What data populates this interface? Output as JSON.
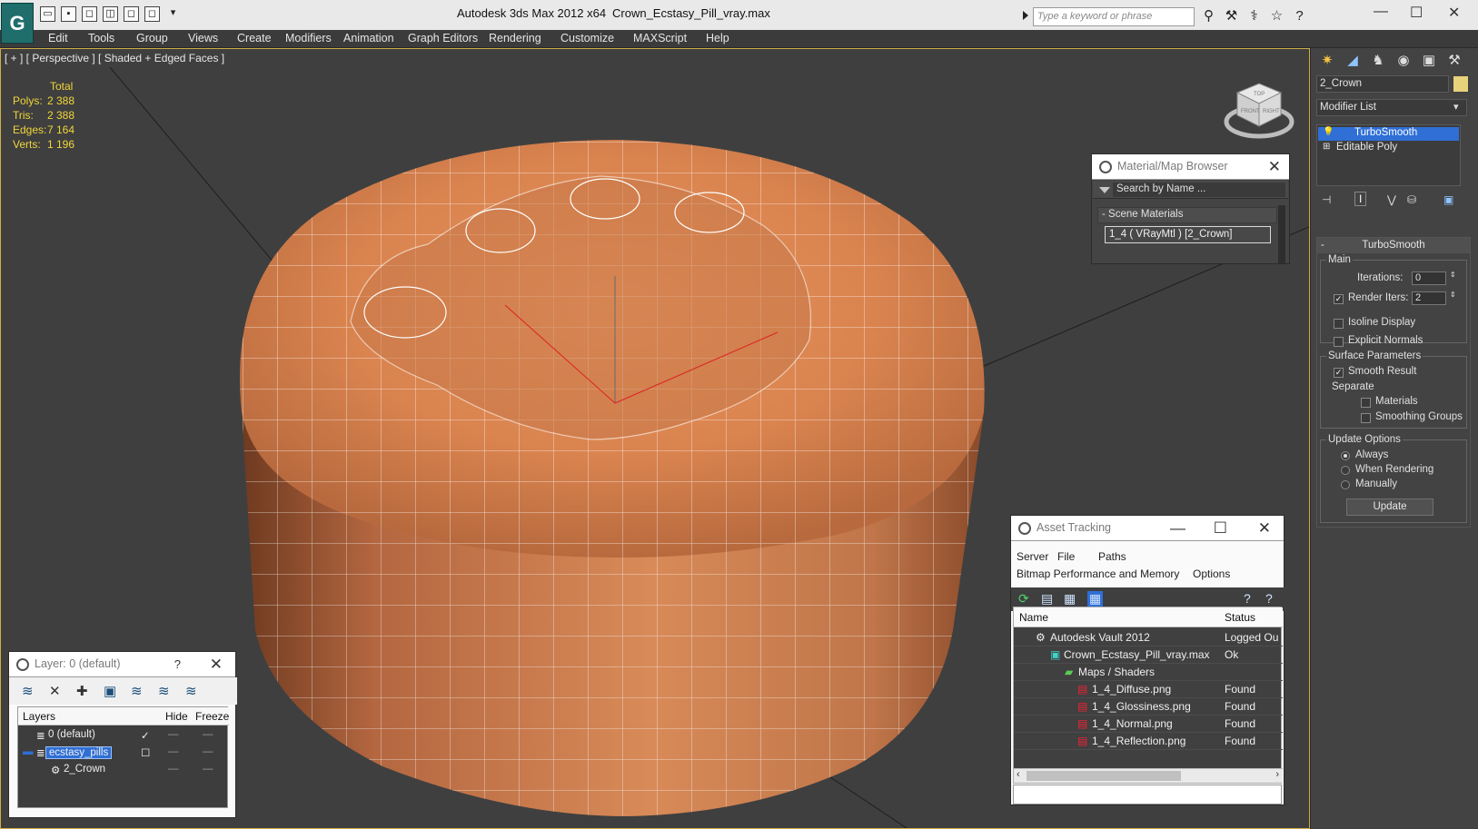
{
  "app": {
    "title": "Autodesk 3ds Max  2012 x64",
    "file": "Crown_Ecstasy_Pill_vray.max",
    "logo_label": "G",
    "search_placeholder": "Type a keyword or phrase"
  },
  "menu": [
    "Edit",
    "Tools",
    "Group",
    "Views",
    "Create",
    "Modifiers",
    "Animation",
    "Graph Editors",
    "Rendering",
    "Customize",
    "MAXScript",
    "Help"
  ],
  "viewport": {
    "label": "[ + ] [ Perspective ] [ Shaded + Edged Faces ]",
    "stats": {
      "header": "Total",
      "rows": [
        {
          "k": "Polys:",
          "v": "2 388"
        },
        {
          "k": "Tris:",
          "v": "2 388"
        },
        {
          "k": "Edges:",
          "v": "7 164"
        },
        {
          "k": "Verts:",
          "v": "1 196"
        }
      ]
    },
    "viewcube": {
      "top": "TOP",
      "front": "FRONT",
      "right": "RIGHT"
    }
  },
  "material_browser": {
    "title": "Material/Map Browser",
    "search": "Search by Name ...",
    "group": "-  Scene Materials",
    "material": "1_4  ( VRayMtl )  [2_Crown]"
  },
  "layer_dialog": {
    "title": "Layer: 0 (default)",
    "help": "?",
    "headers": {
      "name": "Layers",
      "hide": "Hide",
      "freeze": "Freeze"
    },
    "rows": [
      {
        "name": "0 (default)"
      },
      {
        "name": "ecstasy_pills"
      },
      {
        "name": "2_Crown"
      }
    ]
  },
  "asset_tracking": {
    "title": "Asset Tracking",
    "menu1": [
      "Server",
      "File",
      "Paths"
    ],
    "menu2": [
      "Bitmap Performance and Memory",
      "Options"
    ],
    "headers": {
      "name": "Name",
      "status": "Status"
    },
    "rows": [
      {
        "name": "Autodesk Vault 2012",
        "status": "Logged Ou"
      },
      {
        "name": "Crown_Ecstasy_Pill_vray.max",
        "status": "Ok"
      },
      {
        "name": "Maps / Shaders",
        "status": ""
      },
      {
        "name": "1_4_Diffuse.png",
        "status": "Found"
      },
      {
        "name": "1_4_Glossiness.png",
        "status": "Found"
      },
      {
        "name": "1_4_Normal.png",
        "status": "Found"
      },
      {
        "name": "1_4_Reflection.png",
        "status": "Found"
      }
    ]
  },
  "command_panel": {
    "object_name": "2_Crown",
    "modifier_list": "Modifier List",
    "stack": [
      "TurboSmooth",
      "Editable Poly"
    ],
    "rollout_title": "TurboSmooth",
    "main_label": "Main",
    "iterations_label": "Iterations:",
    "iterations": "0",
    "render_iters_label": "Render Iters:",
    "render_iters": "2",
    "isoline": "Isoline Display",
    "explicit_normals": "Explicit Normals",
    "surface_params": "Surface Parameters",
    "smooth_result": "Smooth Result",
    "separate": "Separate",
    "materials": "Materials",
    "smoothing_groups": "Smoothing Groups",
    "update_options": "Update Options",
    "always": "Always",
    "when_rendering": "When Rendering",
    "manually": "Manually",
    "update_button": "Update"
  }
}
